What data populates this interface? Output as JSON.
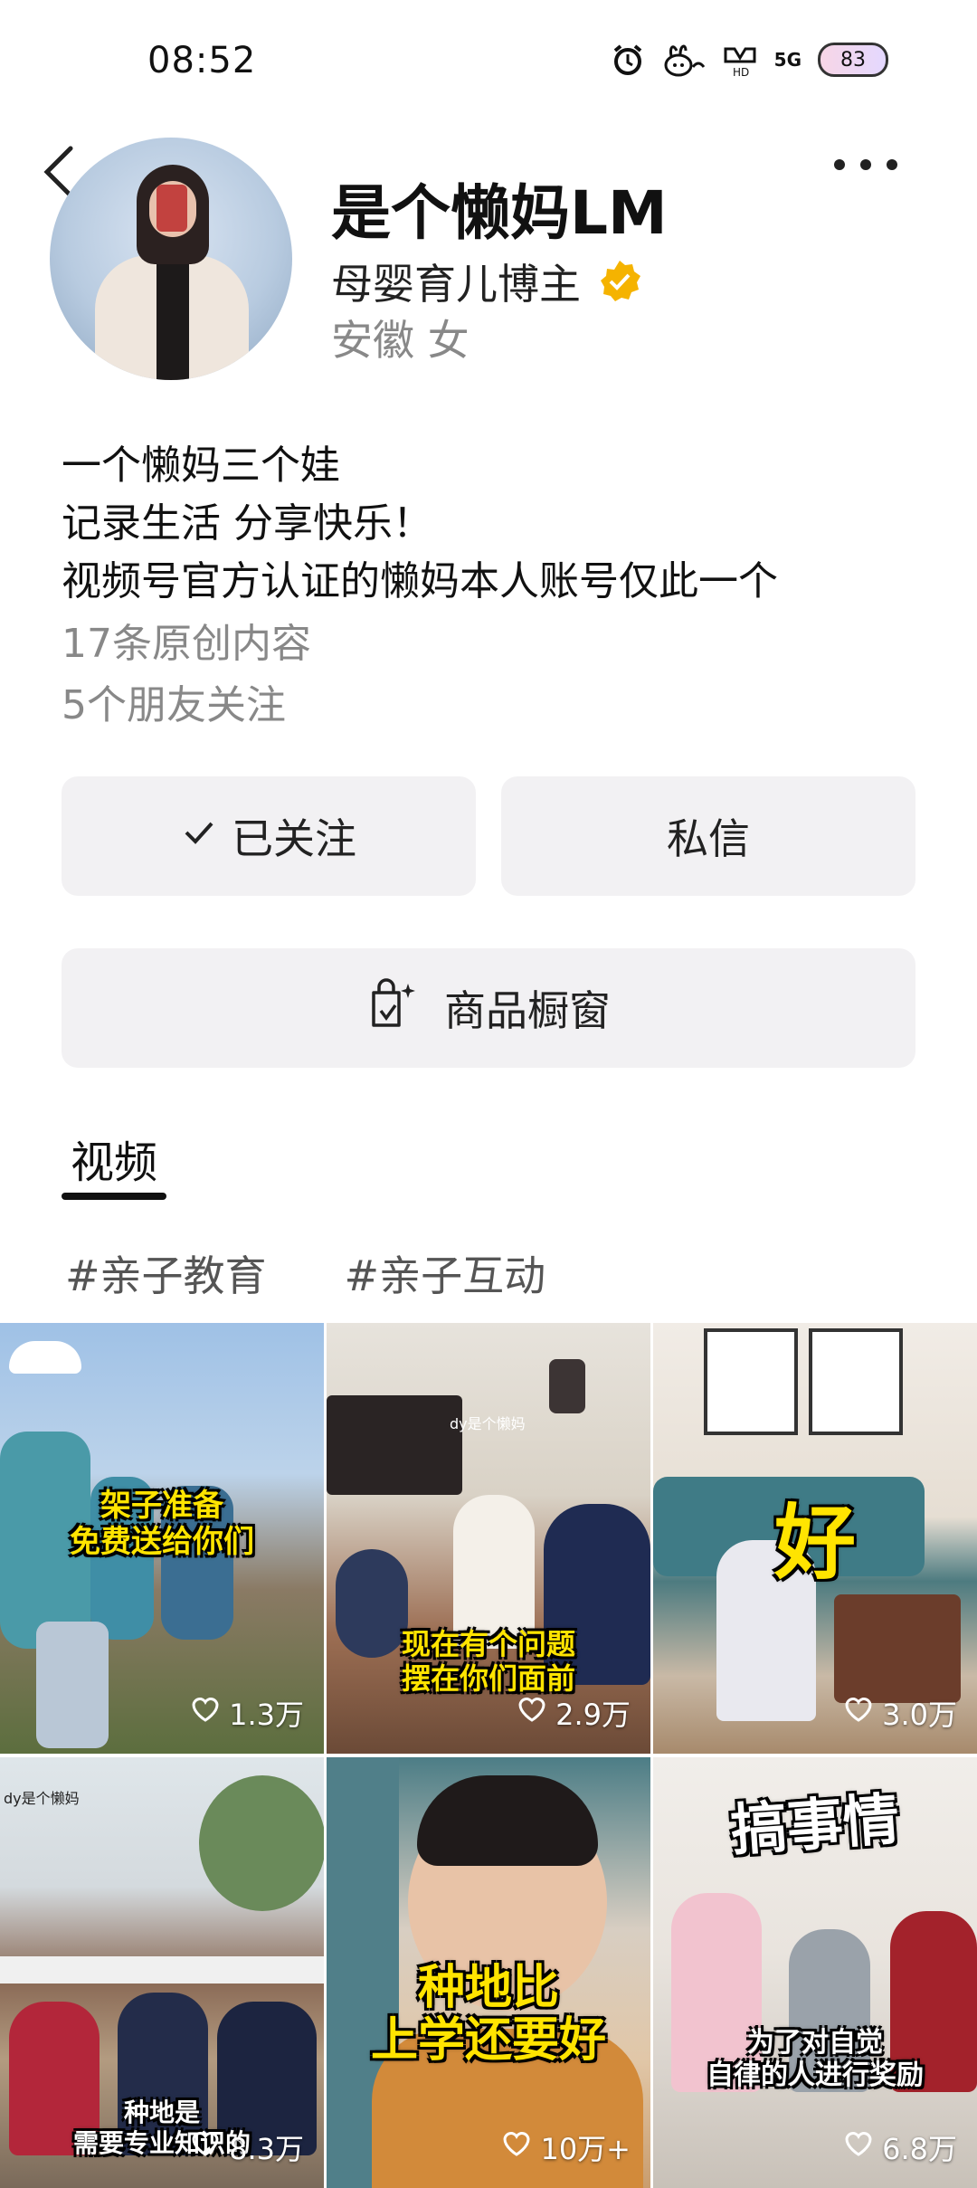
{
  "status_bar": {
    "time": "08:52",
    "network": "5G",
    "battery": "83"
  },
  "profile": {
    "name": "是个懒妈LM",
    "title": "母婴育儿博主",
    "location": "安徽 女",
    "bio": [
      "一个懒妈三个娃",
      "记录生活  分享快乐！",
      "视频号官方认证的懒妈本人账号仅此一个"
    ],
    "original_count": "17条原创内容",
    "friends_follow": "5个朋友关注"
  },
  "actions": {
    "follow_label": "已关注",
    "message_label": "私信",
    "shop_label": "商品橱窗"
  },
  "tabs": {
    "videos": "视频"
  },
  "tags": [
    "#亲子教育",
    "#亲子互动"
  ],
  "videos": [
    {
      "caption": [
        "架子准备",
        "免费送给你们"
      ],
      "likes": "1.3万"
    },
    {
      "caption": [
        "现在有个问题",
        "摆在你们面前"
      ],
      "likes": "2.9万",
      "watermark": "dy是个懒妈"
    },
    {
      "caption": [
        "好"
      ],
      "likes": "3.0万"
    },
    {
      "caption": [
        "种地是",
        "需要专业知识的"
      ],
      "likes": "8.3万",
      "watermark": "dy是个懒妈"
    },
    {
      "caption": [
        "种地比",
        "上学还要好"
      ],
      "likes": "10万+"
    },
    {
      "caption": [
        "搞事情",
        "为了对自觉",
        "自律的人进行奖励"
      ],
      "likes": "6.8万"
    }
  ],
  "icons": [
    "back-icon",
    "more-icon",
    "verified-icon",
    "check-icon",
    "shopping-bag-icon",
    "heart-icon"
  ],
  "colors": {
    "verified": "#f5b300",
    "button_bg": "#f2f1f3",
    "caption": "#ffe400"
  }
}
